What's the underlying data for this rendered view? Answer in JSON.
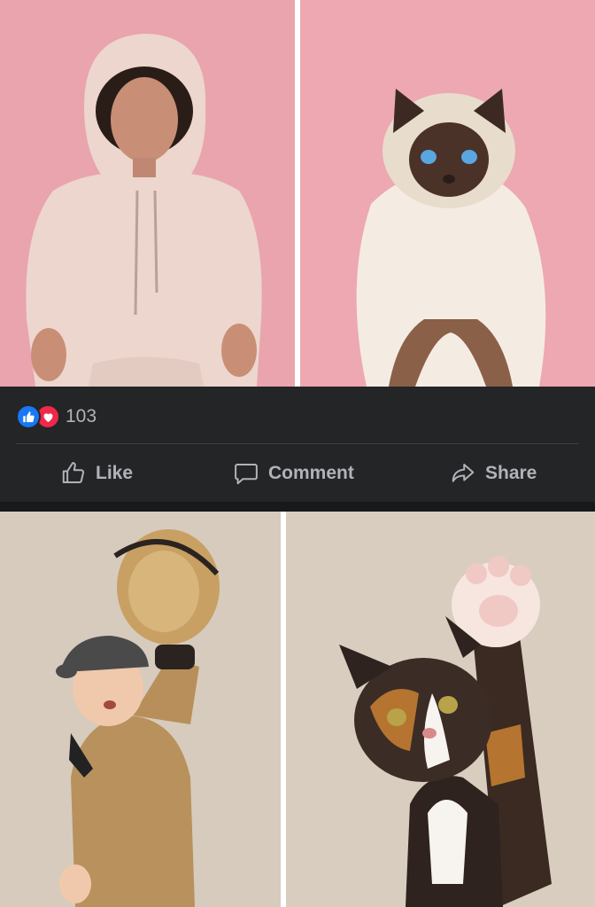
{
  "post": {
    "reactions": {
      "icons": [
        "thumbs-up-icon",
        "heart-icon"
      ],
      "count": "103"
    },
    "actions": {
      "like_label": "Like",
      "comment_label": "Comment",
      "share_label": "Share"
    },
    "colors": {
      "bar_bg": "#242527",
      "text": "#b0b3b8",
      "like_blue": "#1877f2",
      "love_red": "#f0284a"
    }
  },
  "photos": [
    {
      "subject": "woman in pink hoodie"
    },
    {
      "subject": "birman cat"
    },
    {
      "subject": "boy with baseball glove"
    },
    {
      "subject": "calico cat raising paw"
    }
  ]
}
